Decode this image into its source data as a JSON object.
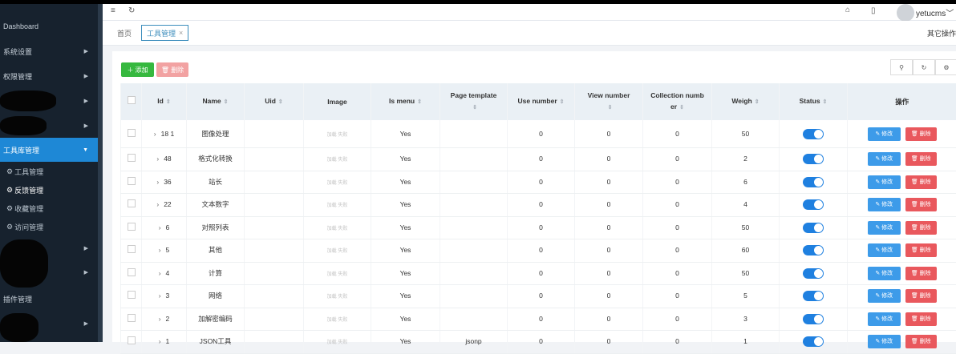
{
  "sidebar": {
    "dashboard": "Dashboard",
    "items": [
      {
        "label": "系统设置"
      },
      {
        "label": "权限管理"
      },
      {
        "label": "工具库管理"
      }
    ],
    "subitems": [
      {
        "label": "工具管理"
      },
      {
        "label": "反馈管理"
      },
      {
        "label": "收藏管理"
      },
      {
        "label": "访问管理"
      }
    ],
    "plugin": "插件管理"
  },
  "header": {
    "username": "yetucms",
    "tab_home": "首页",
    "tab_active": "工具管理",
    "tab_close": "×",
    "other_ops": "其它操作"
  },
  "toolbar": {
    "add_label": "添加",
    "delete_label": "删除"
  },
  "table": {
    "columns": {
      "id": "Id",
      "name": "Name",
      "uid": "Uid",
      "image": "Image",
      "is_menu": "Is menu",
      "page_template": "Page template",
      "use_number": "Use number",
      "view_number": "View number",
      "collection_number": "Collection numb er",
      "weigh": "Weigh",
      "status": "Status",
      "ops": "操作"
    },
    "edit_label": "修改",
    "delete_label": "删除",
    "image_placeholder": "加载 失败",
    "rows": [
      {
        "id": "18 1",
        "name": "图像处理",
        "is_menu": "Yes",
        "page_template": "",
        "use": "0",
        "view": "0",
        "collection": "0",
        "weigh": "50"
      },
      {
        "id": "48",
        "name": "格式化转换",
        "is_menu": "Yes",
        "page_template": "",
        "use": "0",
        "view": "0",
        "collection": "0",
        "weigh": "2"
      },
      {
        "id": "36",
        "name": "站长",
        "is_menu": "Yes",
        "page_template": "",
        "use": "0",
        "view": "0",
        "collection": "0",
        "weigh": "6"
      },
      {
        "id": "22",
        "name": "文本数字",
        "is_menu": "Yes",
        "page_template": "",
        "use": "0",
        "view": "0",
        "collection": "0",
        "weigh": "4"
      },
      {
        "id": "6",
        "name": "对照列表",
        "is_menu": "Yes",
        "page_template": "",
        "use": "0",
        "view": "0",
        "collection": "0",
        "weigh": "50"
      },
      {
        "id": "5",
        "name": "其他",
        "is_menu": "Yes",
        "page_template": "",
        "use": "0",
        "view": "0",
        "collection": "0",
        "weigh": "60"
      },
      {
        "id": "4",
        "name": "计算",
        "is_menu": "Yes",
        "page_template": "",
        "use": "0",
        "view": "0",
        "collection": "0",
        "weigh": "50"
      },
      {
        "id": "3",
        "name": "网络",
        "is_menu": "Yes",
        "page_template": "",
        "use": "0",
        "view": "0",
        "collection": "0",
        "weigh": "5"
      },
      {
        "id": "2",
        "name": "加解密编码",
        "is_menu": "Yes",
        "page_template": "",
        "use": "0",
        "view": "0",
        "collection": "0",
        "weigh": "3"
      },
      {
        "id": "1",
        "name": "JSON工具",
        "is_menu": "Yes",
        "page_template": "jsonp",
        "use": "0",
        "view": "0",
        "collection": "0",
        "weigh": "1"
      }
    ]
  },
  "colors": {
    "sidebar_bg": "#17222e",
    "active": "#1e88d6",
    "add": "#36b83f",
    "edit": "#3d9be9",
    "delete": "#e9585d"
  }
}
